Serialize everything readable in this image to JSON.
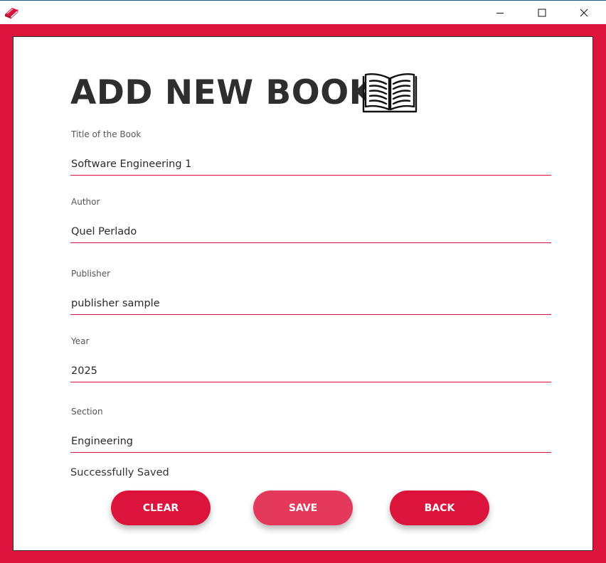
{
  "window": {
    "minimize_icon": "minimize-icon",
    "maximize_icon": "maximize-icon",
    "close_icon": "close-icon",
    "app_icon": "book-app-icon"
  },
  "form": {
    "heading": "ADD NEW BOOK",
    "heading_icon": "open-book-icon",
    "fields": [
      {
        "label": "Title of the Book",
        "value": "Software Engineering 1"
      },
      {
        "label": "Author",
        "value": "Quel Perlado"
      },
      {
        "label": "Publisher",
        "value": "publisher sample"
      },
      {
        "label": "Year",
        "value": "2025"
      },
      {
        "label": "Section",
        "value": "Engineering"
      }
    ],
    "status": "Successfully Saved"
  },
  "buttons": {
    "clear": "CLEAR",
    "save": "SAVE",
    "back": "BACK"
  },
  "colors": {
    "accent": "#dc143c",
    "save_button": "#e4395a",
    "heading": "#2e2e2e"
  }
}
